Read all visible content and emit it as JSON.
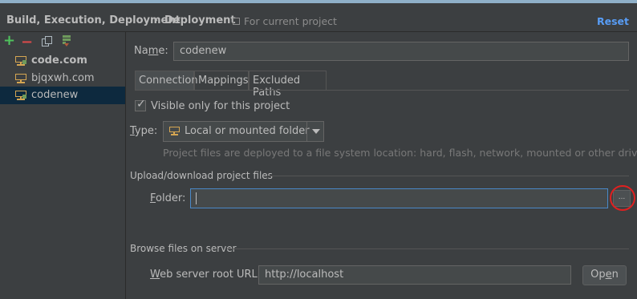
{
  "header": {
    "section": "Build, Execution, Deployment",
    "separator": "›",
    "page": "Deployment",
    "scope": "For current project",
    "reset_label": "Reset"
  },
  "toolbar": {
    "add_icon": "+",
    "remove_icon": "−"
  },
  "servers": [
    {
      "label": "code.com",
      "bold": true,
      "default": true
    },
    {
      "label": "bjqxwh.com",
      "bold": false,
      "default": false
    },
    {
      "label": "codenew",
      "bold": false,
      "default": false,
      "selected": true
    }
  ],
  "name_field": {
    "label_prefix": "Na",
    "label_mnemonic": "m",
    "label_suffix": "e:",
    "value": "codenew"
  },
  "tabs": [
    {
      "label": "Connection",
      "active": true
    },
    {
      "label": "Mappings",
      "active": false
    },
    {
      "label": "Excluded Paths",
      "active": false
    }
  ],
  "visible_only": {
    "checked": true,
    "check_glyph": "✓",
    "label": "Visible only for this project"
  },
  "type_field": {
    "label_mnemonic": "T",
    "label_rest": "ype:",
    "value": "Local or mounted folder",
    "hint": "Project files are deployed to a file system location: hard, flash, network, mounted or other drive."
  },
  "upload_section": {
    "title": "Upload/download project files",
    "folder_label_mnemonic": "F",
    "folder_label_rest": "older:",
    "folder_value": "",
    "browse_label": "..."
  },
  "browse_section": {
    "title": "Browse files on server",
    "url_label_mnemonic": "W",
    "url_label_rest": "eb server root URL:",
    "url_value": "http://localhost",
    "open_label_prefix": "Op",
    "open_label_mnemonic": "e",
    "open_label_suffix": "n"
  },
  "colors": {
    "background": "#3c3f41",
    "text": "#bbbbbb",
    "accent": "#589df6",
    "selection": "#0d293e",
    "folder_icon": "#d5a652",
    "highlight": "#e02020"
  }
}
